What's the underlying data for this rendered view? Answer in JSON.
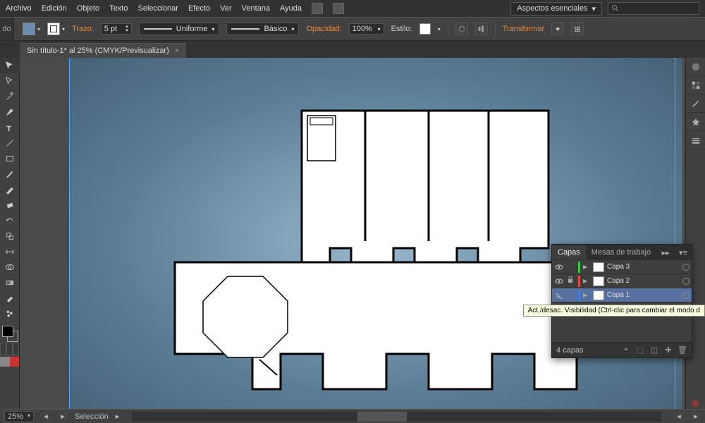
{
  "menu": {
    "items": [
      "Archivo",
      "Edición",
      "Objeto",
      "Texto",
      "Seleccionar",
      "Efecto",
      "Ver",
      "Ventana",
      "Ayuda"
    ],
    "workspace": "Aspectos esenciales",
    "search_placeholder": ""
  },
  "control": {
    "left_label": "do",
    "trazo_label": "Trazo:",
    "trazo_value": "5 pt",
    "dash1": "Uniforme",
    "dash2": "Básico",
    "opacity_label": "Opacidad:",
    "opacity_value": "100%",
    "style_label": "Estilo:",
    "transform_label": "Transformar"
  },
  "tab": {
    "title": "Sin título-1* al 25% (CMYK/Previsualizar)"
  },
  "layers": {
    "tab1": "Capas",
    "tab2": "Mesas de trabajo",
    "items": [
      {
        "name": "Capa 3",
        "color": "#2ecc40",
        "vis": true,
        "lock": false,
        "sel": false
      },
      {
        "name": "Capa 2",
        "color": "#e74c3c",
        "vis": true,
        "lock": true,
        "sel": false
      },
      {
        "name": "Capa 1",
        "color": "#3b7dd8",
        "vis": true,
        "lock": false,
        "sel": true
      }
    ],
    "count": "4 capas"
  },
  "tooltip": "Act./desac. Visibilidad (Ctrl-clic para cambiar el modo d",
  "status": {
    "zoom": "25%",
    "mode": "Selección"
  },
  "colors": {
    "accent": "#e68a3e",
    "panel": "#3e3e3e"
  }
}
